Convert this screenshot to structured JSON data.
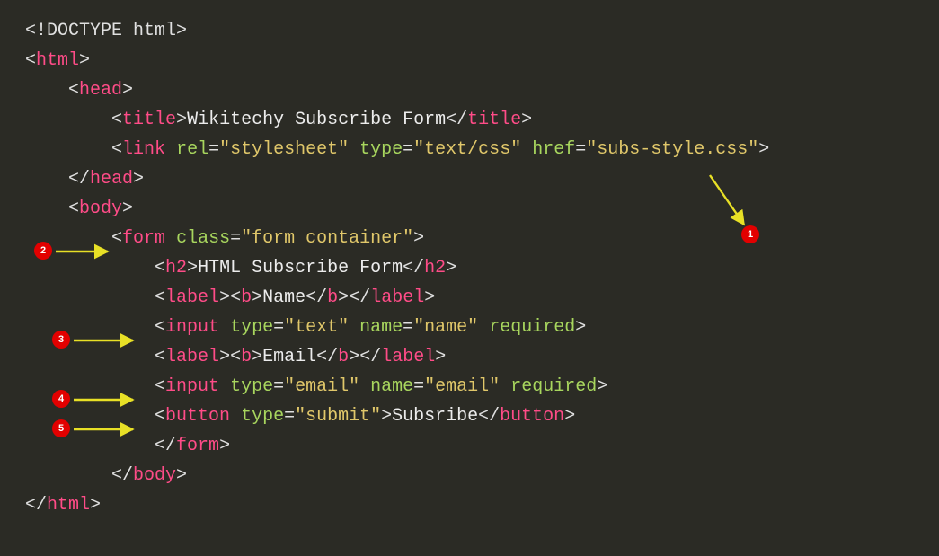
{
  "code": {
    "l1": "<!DOCTYPE html>",
    "l2": {
      "open": "<",
      "tag": "html",
      "close": ">"
    },
    "l3": {
      "open": "<",
      "tag": "head",
      "close": ">"
    },
    "l4": {
      "open": "<",
      "tag": "title",
      "close": ">",
      "text": "Wikitechy Subscribe Form",
      "copen": "</",
      "ctag": "title",
      "cclose": ">"
    },
    "l5": {
      "open": "<",
      "tag": "link",
      "sp": " ",
      "a1": "rel",
      "eq": "=",
      "v1": "\"stylesheet\"",
      "a2": "type",
      "v2": "\"text/css\"",
      "a3": "href",
      "v3": "\"subs-style.css\"",
      "close": ">"
    },
    "l6": {
      "open": "</",
      "tag": "head",
      "close": ">"
    },
    "l7": {
      "open": "<",
      "tag": "body",
      "close": ">"
    },
    "l8": {
      "open": "<",
      "tag": "form",
      "sp": " ",
      "a1": "class",
      "eq": "=",
      "v1": "\"form container\"",
      "close": ">"
    },
    "l9": {
      "open": "<",
      "tag": "h2",
      "close": ">",
      "text": "HTML Subscribe Form",
      "copen": "</",
      "ctag": "h2",
      "cclose": ">"
    },
    "l10": {
      "o1": "<",
      "t1": "label",
      "c1": ">",
      "o2": "<",
      "t2": "b",
      "c2": ">",
      "text": "Name",
      "o3": "</",
      "t3": "b",
      "c3": ">",
      "o4": "</",
      "t4": "label",
      "c4": ">"
    },
    "l11": {
      "open": "<",
      "tag": "input",
      "sp": " ",
      "a1": "type",
      "eq": "=",
      "v1": "\"text\"",
      "a2": "name",
      "v2": "\"name\"",
      "a3": "required",
      "close": ">"
    },
    "l12": {
      "o1": "<",
      "t1": "label",
      "c1": ">",
      "o2": "<",
      "t2": "b",
      "c2": ">",
      "text": "Email",
      "o3": "</",
      "t3": "b",
      "c3": ">",
      "o4": "</",
      "t4": "label",
      "c4": ">"
    },
    "l13": {
      "open": "<",
      "tag": "input",
      "sp": " ",
      "a1": "type",
      "eq": "=",
      "v1": "\"email\"",
      "a2": "name",
      "v2": "\"email\"",
      "a3": "required",
      "close": ">"
    },
    "l14": {
      "open": "<",
      "tag": "button",
      "sp": " ",
      "a1": "type",
      "eq": "=",
      "v1": "\"submit\"",
      "close": ">",
      "text": "Subsribe",
      "copen": "</",
      "ctag": "button",
      "cclose": ">"
    },
    "l15": {
      "open": "</",
      "tag": "form",
      "close": ">"
    },
    "l16": {
      "open": "</",
      "tag": "body",
      "close": ">"
    },
    "l17": {
      "open": "</",
      "tag": "html",
      "close": ">"
    }
  },
  "badges": {
    "b1": "1",
    "b2": "2",
    "b3": "3",
    "b4": "4",
    "b5": "5"
  },
  "indent": {
    "i0": "",
    "i1": "    ",
    "i2": "        ",
    "i3": "            "
  }
}
